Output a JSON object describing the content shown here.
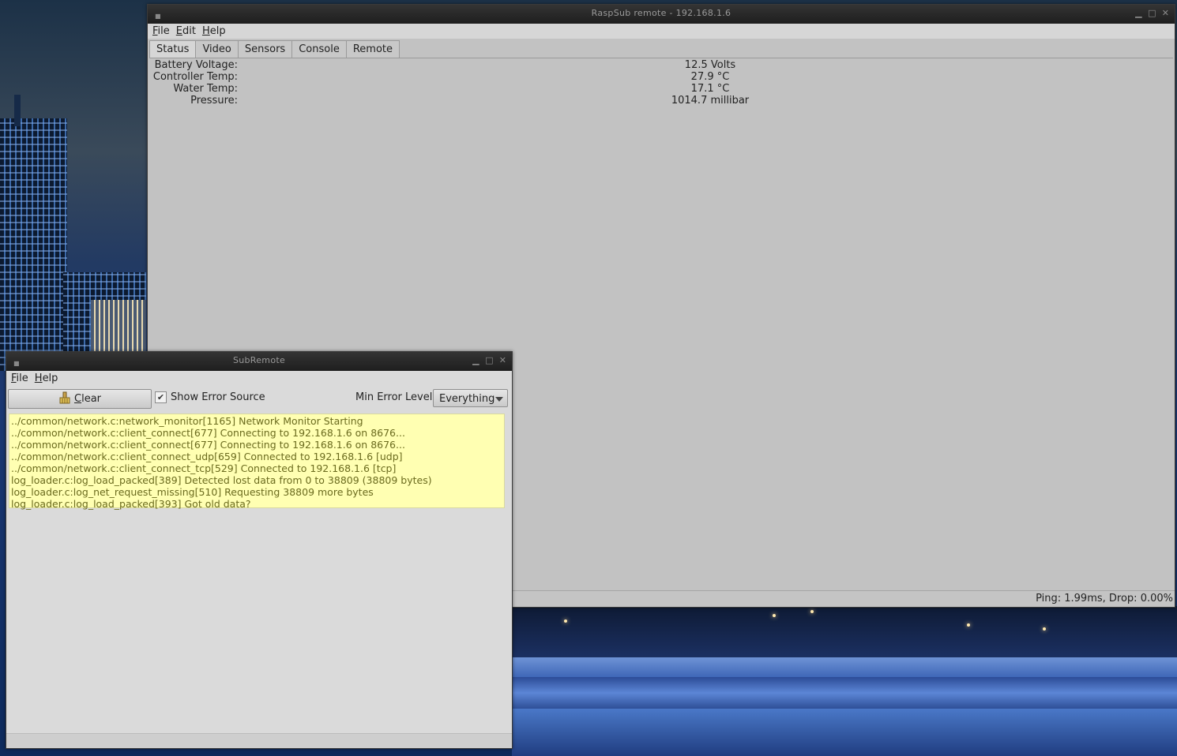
{
  "main_window": {
    "title": "RaspSub remote - 192.168.1.6",
    "menus": [
      {
        "label": "File",
        "accel": "F",
        "rest": "ile"
      },
      {
        "label": "Edit",
        "accel": "E",
        "rest": "dit"
      },
      {
        "label": "Help",
        "accel": "H",
        "rest": "elp"
      }
    ],
    "tabs": [
      "Status",
      "Video",
      "Sensors",
      "Console",
      "Remote"
    ],
    "active_tab": "Status",
    "status": [
      {
        "label": "Battery Voltage:",
        "value": "12.5 Volts"
      },
      {
        "label": "Controller Temp:",
        "value": "27.9 °C"
      },
      {
        "label": "Water Temp:",
        "value": "17.1 °C"
      },
      {
        "label": "Pressure:",
        "value": "1014.7 millibar"
      }
    ],
    "footer": "Ping: 1.99ms, Drop: 0.00%"
  },
  "sub_window": {
    "title": "SubRemote",
    "menus": [
      {
        "label": "File",
        "accel": "F",
        "rest": "ile"
      },
      {
        "label": "Help",
        "accel": "H",
        "rest": "elp"
      }
    ],
    "clear_button": {
      "accel": "C",
      "rest": "lear"
    },
    "show_error_source": {
      "label": "Show Error Source",
      "checked": true
    },
    "min_error_level_label": "Min Error Level",
    "min_error_level_value": "Everything",
    "log_lines": [
      "../common/network.c:network_monitor[1165] Network Monitor Starting",
      "../common/network.c:client_connect[677] Connecting to 192.168.1.6 on 8676...",
      "../common/network.c:client_connect[677] Connecting to 192.168.1.6 on 8676...",
      "../common/network.c:client_connect_udp[659] Connected to 192.168.1.6 [udp]",
      "../common/network.c:client_connect_tcp[529] Connected to 192.168.1.6 [tcp]",
      "log_loader.c:log_load_packed[389] Detected lost data from 0 to 38809 (38809 bytes)",
      "log_loader.c:log_net_request_missing[510] Requesting 38809 more bytes",
      "log_loader.c:log_load_packed[393] Got old data?"
    ],
    "log_bg_color": "#ffffb2"
  },
  "icons": {
    "window_minimize": "minimize-icon",
    "window_maximize": "maximize-icon",
    "window_close": "close-icon",
    "clear": "broom-icon",
    "dropdown": "chevron-down-icon"
  }
}
